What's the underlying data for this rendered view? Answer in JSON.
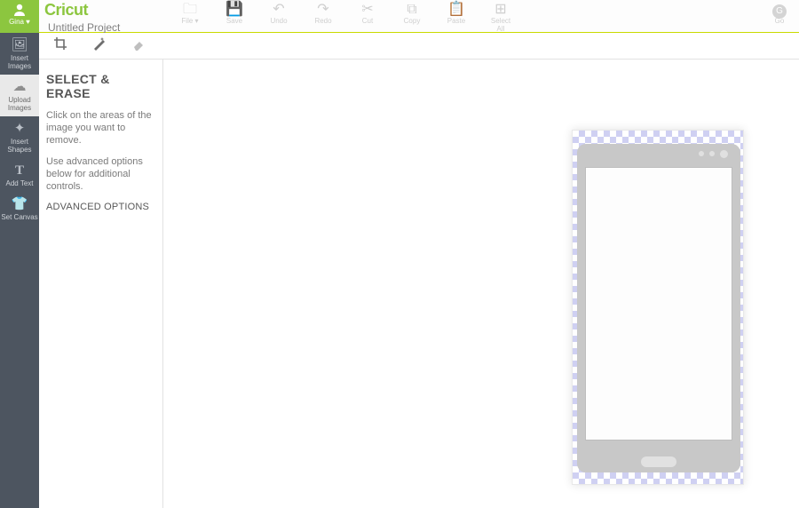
{
  "user": {
    "name": "Gina ♥"
  },
  "brand": "Cricut",
  "project_title": "Untitled Project",
  "top_actions": [
    {
      "label": "File ▾",
      "icon": "🗀"
    },
    {
      "label": "Save",
      "icon": "💾"
    },
    {
      "label": "Undo",
      "icon": "↶"
    },
    {
      "label": "Redo",
      "icon": "↷"
    },
    {
      "label": "Cut",
      "icon": "✂"
    },
    {
      "label": "Copy",
      "icon": "⧉"
    },
    {
      "label": "Paste",
      "icon": "📋"
    },
    {
      "label": "Select All",
      "icon": "⊞"
    },
    {
      "label": "",
      "icon": ""
    },
    {
      "label": "",
      "icon": ""
    }
  ],
  "go": {
    "label": "Go",
    "glyph": "G"
  },
  "rail": [
    {
      "label": "Insert\nImages",
      "icon": "🖼"
    },
    {
      "label": "Upload\nImages",
      "icon": "☁"
    },
    {
      "label": "Insert\nShapes",
      "icon": "✦"
    },
    {
      "label": "Add Text",
      "icon": "T"
    },
    {
      "label": "Set Canvas",
      "icon": "👕"
    }
  ],
  "panel": {
    "title": "SELECT & ERASE",
    "desc1": "Click on the areas of the image you want to remove.",
    "desc2": "Use advanced options below for additional controls.",
    "advanced": "ADVANCED OPTIONS"
  }
}
